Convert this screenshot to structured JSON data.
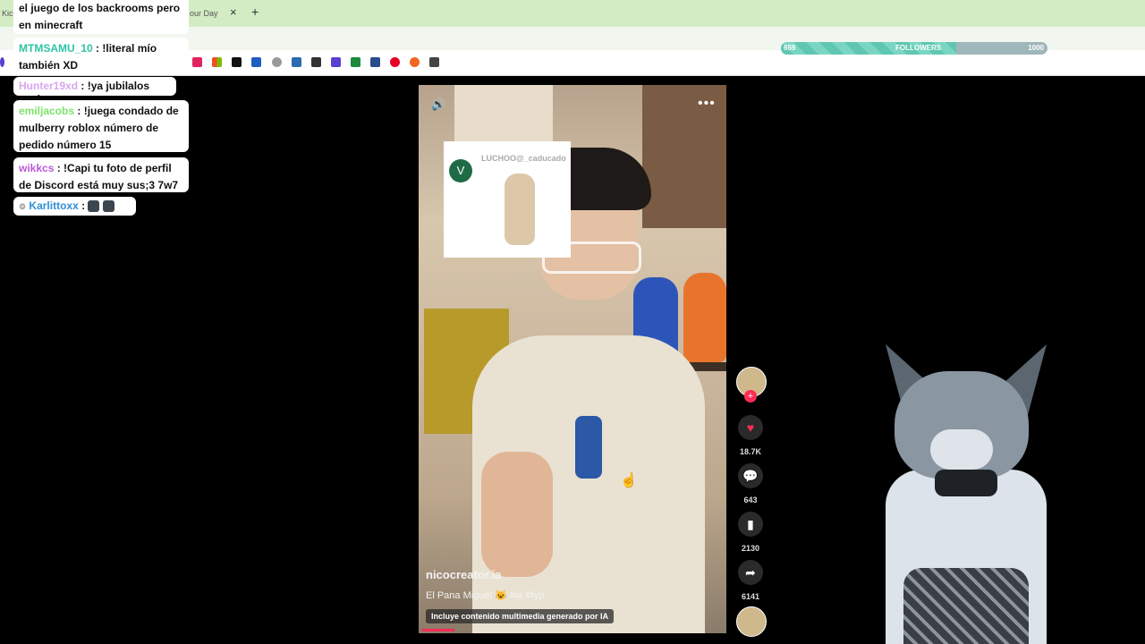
{
  "browser": {
    "tab_fragment_left": "Kic",
    "tab_title_fragment": "our Day",
    "close_glyph": "×",
    "new_tab_glyph": "+"
  },
  "follower_goal": {
    "current": "659",
    "label": "FOLLOWERS",
    "goal": "1000",
    "progress_fraction": 0.659
  },
  "chat": [
    {
      "user": "",
      "message": "el juego de los backrooms pero en minecraft",
      "user_color": "#111111"
    },
    {
      "user": "MTMSAMU_10",
      "message": ": !literal mío también XD",
      "user_color": "#2fc4a6"
    },
    {
      "user": "Hunter19xd",
      "message": ": !ya jubilalos capi",
      "user_color": "#d7a6ef"
    },
    {
      "user": "emiljacobs",
      "message": ": !juega condado de mulberry roblox número de pedido número 15",
      "user_color": "#7ee36c"
    },
    {
      "user": "wikkcs",
      "message": ": !Capi tu foto de perfil de Discord está muy sus;3 7w7",
      "user_color": "#b85bd6"
    },
    {
      "user": "Karlittoxx",
      "message": ":",
      "user_color": "#2f8fd6"
    }
  ],
  "video": {
    "overlay_avatar_letter": "V",
    "overlay_handle": "LUCHOO@_caducado",
    "creator_handle": "nicocreator.ia",
    "caption": "El Pana Miguel 😺 #ia #fyp",
    "ai_notice": "Incluye contenido multimedia generado por IA",
    "volume_icon": "🔊",
    "more_icon": "•••"
  },
  "actions": {
    "likes": "18.7K",
    "comments": "643",
    "saves": "2130",
    "shares": "6141",
    "like_color": "#fe2c55"
  }
}
